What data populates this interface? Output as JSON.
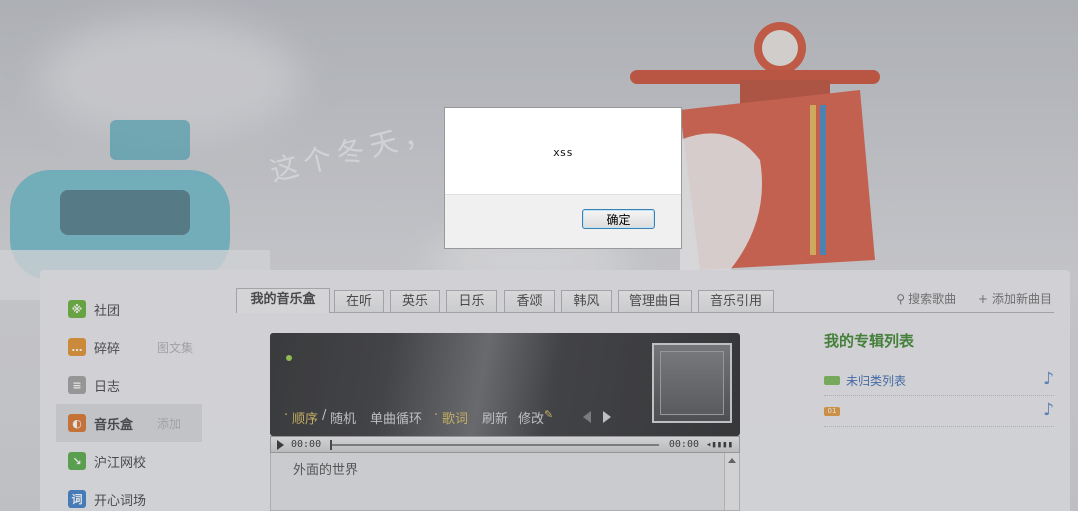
{
  "background": {
    "calligraphy": "这个冬天，"
  },
  "sidebar": {
    "items": [
      {
        "label": "社团",
        "icon": "group-icon",
        "color": "#5bab2a",
        "glyph": "※",
        "extra": ""
      },
      {
        "label": "碎碎",
        "icon": "chat-bubble-icon",
        "color": "#e08a1e",
        "glyph": "…",
        "extra": "图文集"
      },
      {
        "label": "日志",
        "icon": "notebook-icon",
        "color": "#9a9a9a",
        "glyph": "≡",
        "extra": ""
      },
      {
        "label": "音乐盒",
        "icon": "music-box-icon",
        "color": "#d96a1c",
        "glyph": "◐",
        "extra": "添加"
      },
      {
        "label": "沪江网校",
        "icon": "school-icon",
        "color": "#4aa53a",
        "glyph": "↘",
        "extra": ""
      },
      {
        "label": "开心词场",
        "icon": "vocabulary-icon",
        "color": "#2f76c6",
        "glyph": "词",
        "extra": ""
      }
    ]
  },
  "tabs": [
    "我的音乐盒",
    "在听",
    "英乐",
    "日乐",
    "香颂",
    "韩风",
    "管理曲目",
    "音乐引用"
  ],
  "tools": {
    "search_label": "搜索歌曲",
    "add_label": "添加新曲目"
  },
  "player": {
    "mode_order": "顺序",
    "mode_sep": "/",
    "mode_random": "随机",
    "single_loop": "单曲循环",
    "lyrics": "歌词",
    "refresh": "刷新",
    "edit": "修改",
    "time_current": "00:00",
    "time_total": "00:00",
    "playlist_first": "外面的世界"
  },
  "albums": {
    "title": "我的专辑列表",
    "items": [
      {
        "name": "未归类列表",
        "tag": "",
        "tag_color": "#6fb34a"
      },
      {
        "name": "",
        "tag": "01",
        "tag_color": "#e0902c"
      }
    ]
  },
  "dialog": {
    "message": "xss",
    "ok_label": "确定"
  }
}
